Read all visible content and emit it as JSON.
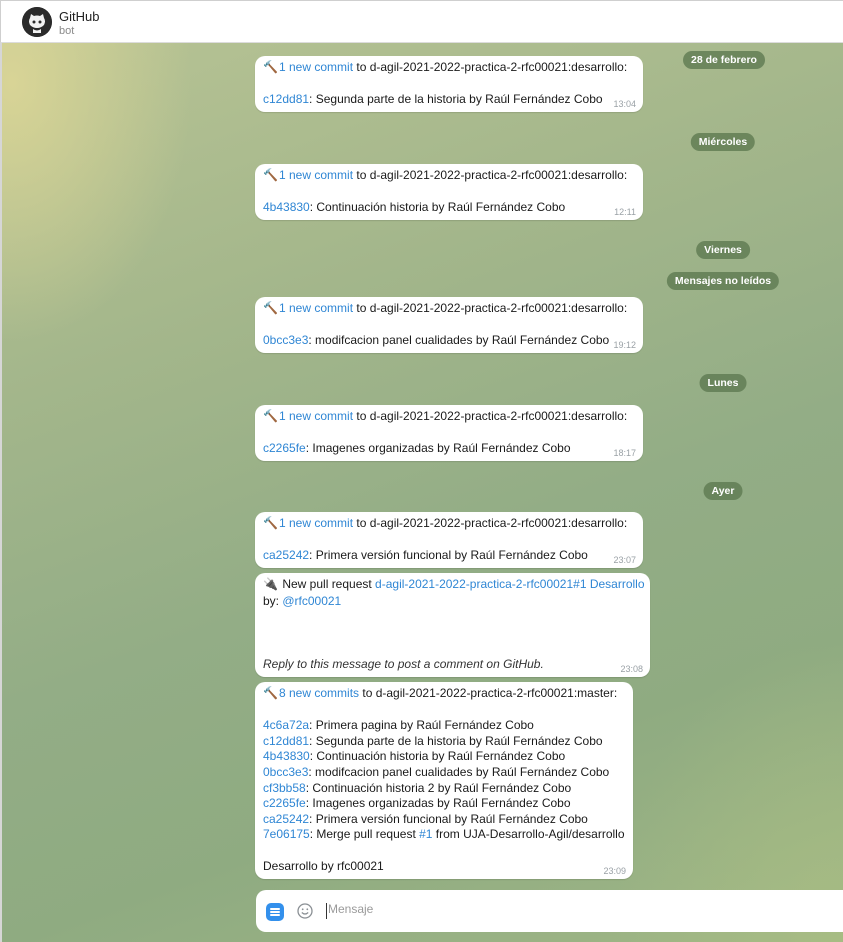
{
  "header": {
    "title": "GitHub",
    "subtitle": "bot"
  },
  "dates": {
    "d1": "28 de febrero",
    "d2": "Miércoles",
    "d3": "Viernes",
    "unread": "Mensajes no leídos",
    "d4": "Lunes",
    "d5": "Ayer"
  },
  "messages": [
    {
      "link_text": "1 new commit",
      "rest": " to d-agil-2021-2022-practica-2-rfc00021:desarrollo:",
      "hash": "c12dd81",
      "desc": ": Segunda parte de la historia by Raúl Fernández Cobo",
      "time": "13:04"
    },
    {
      "link_text": "1 new commit",
      "rest": " to d-agil-2021-2022-practica-2-rfc00021:desarrollo:",
      "hash": "4b43830",
      "desc": ": Continuación historia by Raúl Fernández Cobo",
      "time": "12:11"
    },
    {
      "link_text": "1 new commit",
      "rest": " to d-agil-2021-2022-practica-2-rfc00021:desarrollo:",
      "hash": "0bcc3e3",
      "desc": ": modifcacion panel cualidades by Raúl Fernández Cobo",
      "time": "19:12"
    },
    {
      "link_text": "1 new commit",
      "rest": " to d-agil-2021-2022-practica-2-rfc00021:desarrollo:",
      "hash": "c2265fe",
      "desc": ": Imagenes organizadas by Raúl Fernández Cobo",
      "time": "18:17"
    },
    {
      "link_text": "1 new commit",
      "rest": " to d-agil-2021-2022-practica-2-rfc00021:desarrollo:",
      "hash": "ca25242",
      "desc": ": Primera versión funcional by Raúl Fernández Cobo",
      "time": "23:07"
    }
  ],
  "pull_request": {
    "label": " New pull request ",
    "link": "d-agil-2021-2022-practica-2-rfc00021#1 Desarrollo",
    "by": "by: ",
    "user": "@rfc00021",
    "reply_hint": "Reply to this message to post a comment on GitHub.",
    "time": "23:08"
  },
  "master_push": {
    "link_text": "8 new commits",
    "rest": " to d-agil-2021-2022-practica-2-rfc00021:master:",
    "commits": [
      {
        "hash": "4c6a72a",
        "desc": ": Primera pagina by Raúl Fernández Cobo"
      },
      {
        "hash": "c12dd81",
        "desc": ": Segunda parte de la historia by Raúl Fernández Cobo"
      },
      {
        "hash": "4b43830",
        "desc": ": Continuación historia by Raúl Fernández Cobo"
      },
      {
        "hash": "0bcc3e3",
        "desc": ": modifcacion panel cualidades by Raúl Fernández Cobo"
      },
      {
        "hash": "cf3bb58",
        "desc": ": Continuación historia 2 by Raúl Fernández Cobo"
      },
      {
        "hash": "c2265fe",
        "desc": ": Imagenes organizadas by Raúl Fernández Cobo"
      },
      {
        "hash": "ca25242",
        "desc": ": Primera versión funcional by Raúl Fernández Cobo"
      },
      {
        "hash": "7e06175",
        "desc_a": ": Merge pull request ",
        "pr": "#1",
        "desc_b": " from UJA-Desarrollo-Agil/desarrollo"
      }
    ],
    "footer": "Desarrollo by rfc00021",
    "time": "23:09"
  },
  "composer": {
    "placeholder": "Mensaje"
  },
  "icons": {
    "avatar": "github-octocat-icon",
    "commit": "hammer-icon",
    "pr": "plug-icon",
    "menu": "menu-icon",
    "emoji": "smiley-icon"
  },
  "colors": {
    "link": "#2f86d4",
    "date_pill": "#5c7850",
    "menu_button": "#3390ec"
  }
}
